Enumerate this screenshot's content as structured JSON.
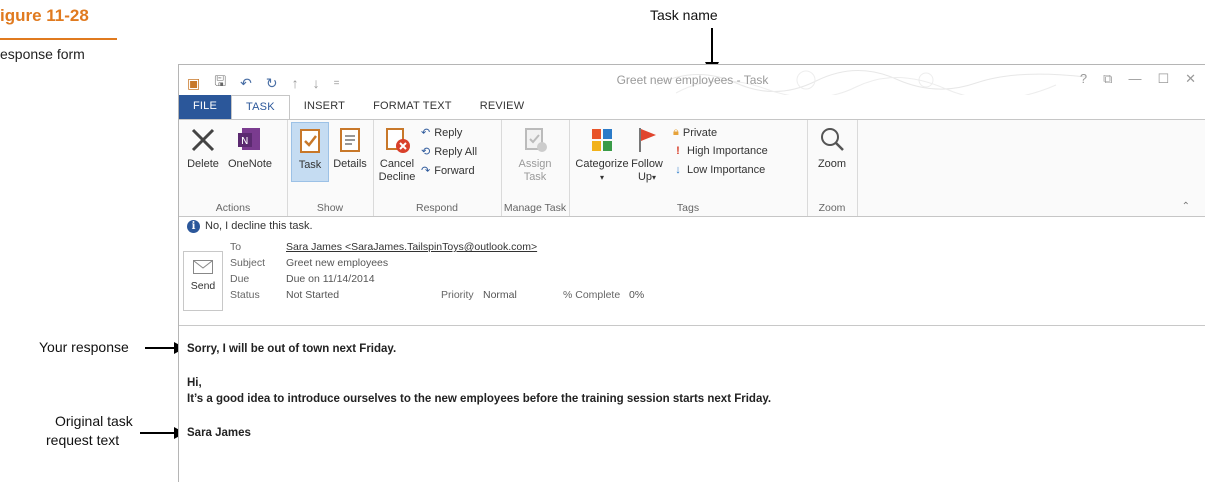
{
  "figure": {
    "title": "igure 11-28",
    "subtitle": "esponse form"
  },
  "callouts": {
    "task_name": "Task name",
    "your_response": "Your response",
    "original_line1": "Original task",
    "original_line2": "request text"
  },
  "window": {
    "title": "Greet new employees - Task",
    "controls": [
      "?",
      "⧉",
      "—",
      "☐",
      "✕"
    ]
  },
  "tabs": [
    "FILE",
    "TASK",
    "INSERT",
    "FORMAT TEXT",
    "REVIEW"
  ],
  "ribbon": {
    "actions": {
      "label": "Actions",
      "delete": "Delete",
      "onenote": "OneNote"
    },
    "show": {
      "label": "Show",
      "task": "Task",
      "details": "Details"
    },
    "respond": {
      "label": "Respond",
      "cancel_decline_1": "Cancel",
      "cancel_decline_2": "Decline",
      "reply": "Reply",
      "reply_all": "Reply All",
      "forward": "Forward"
    },
    "manage": {
      "label": "Manage Task",
      "assign_1": "Assign",
      "assign_2": "Task"
    },
    "tags": {
      "label": "Tags",
      "categorize": "Categorize",
      "follow_1": "Follow",
      "follow_2": "Up",
      "private": "Private",
      "high": "High Importance",
      "low": "Low Importance"
    },
    "zoom": {
      "label": "Zoom",
      "zoom": "Zoom"
    }
  },
  "info_text": "No, I decline this task.",
  "header": {
    "send": "Send",
    "to_label": "To",
    "to_value": "Sara James <SaraJames.TailspinToys@outlook.com>",
    "subject_label": "Subject",
    "subject_value": "Greet new employees",
    "due_label": "Due",
    "due_value": "Due on 11/14/2014",
    "status_label": "Status",
    "status_value": "Not Started",
    "priority_label": "Priority",
    "priority_value": "Normal",
    "complete_label": "% Complete",
    "complete_value": "0%"
  },
  "body": {
    "response": "Sorry, I will be out of town next Friday.",
    "greeting": "Hi,",
    "message": "It’s a good idea to introduce ourselves to the new employees before the training session starts next Friday.",
    "signature": "Sara James"
  }
}
